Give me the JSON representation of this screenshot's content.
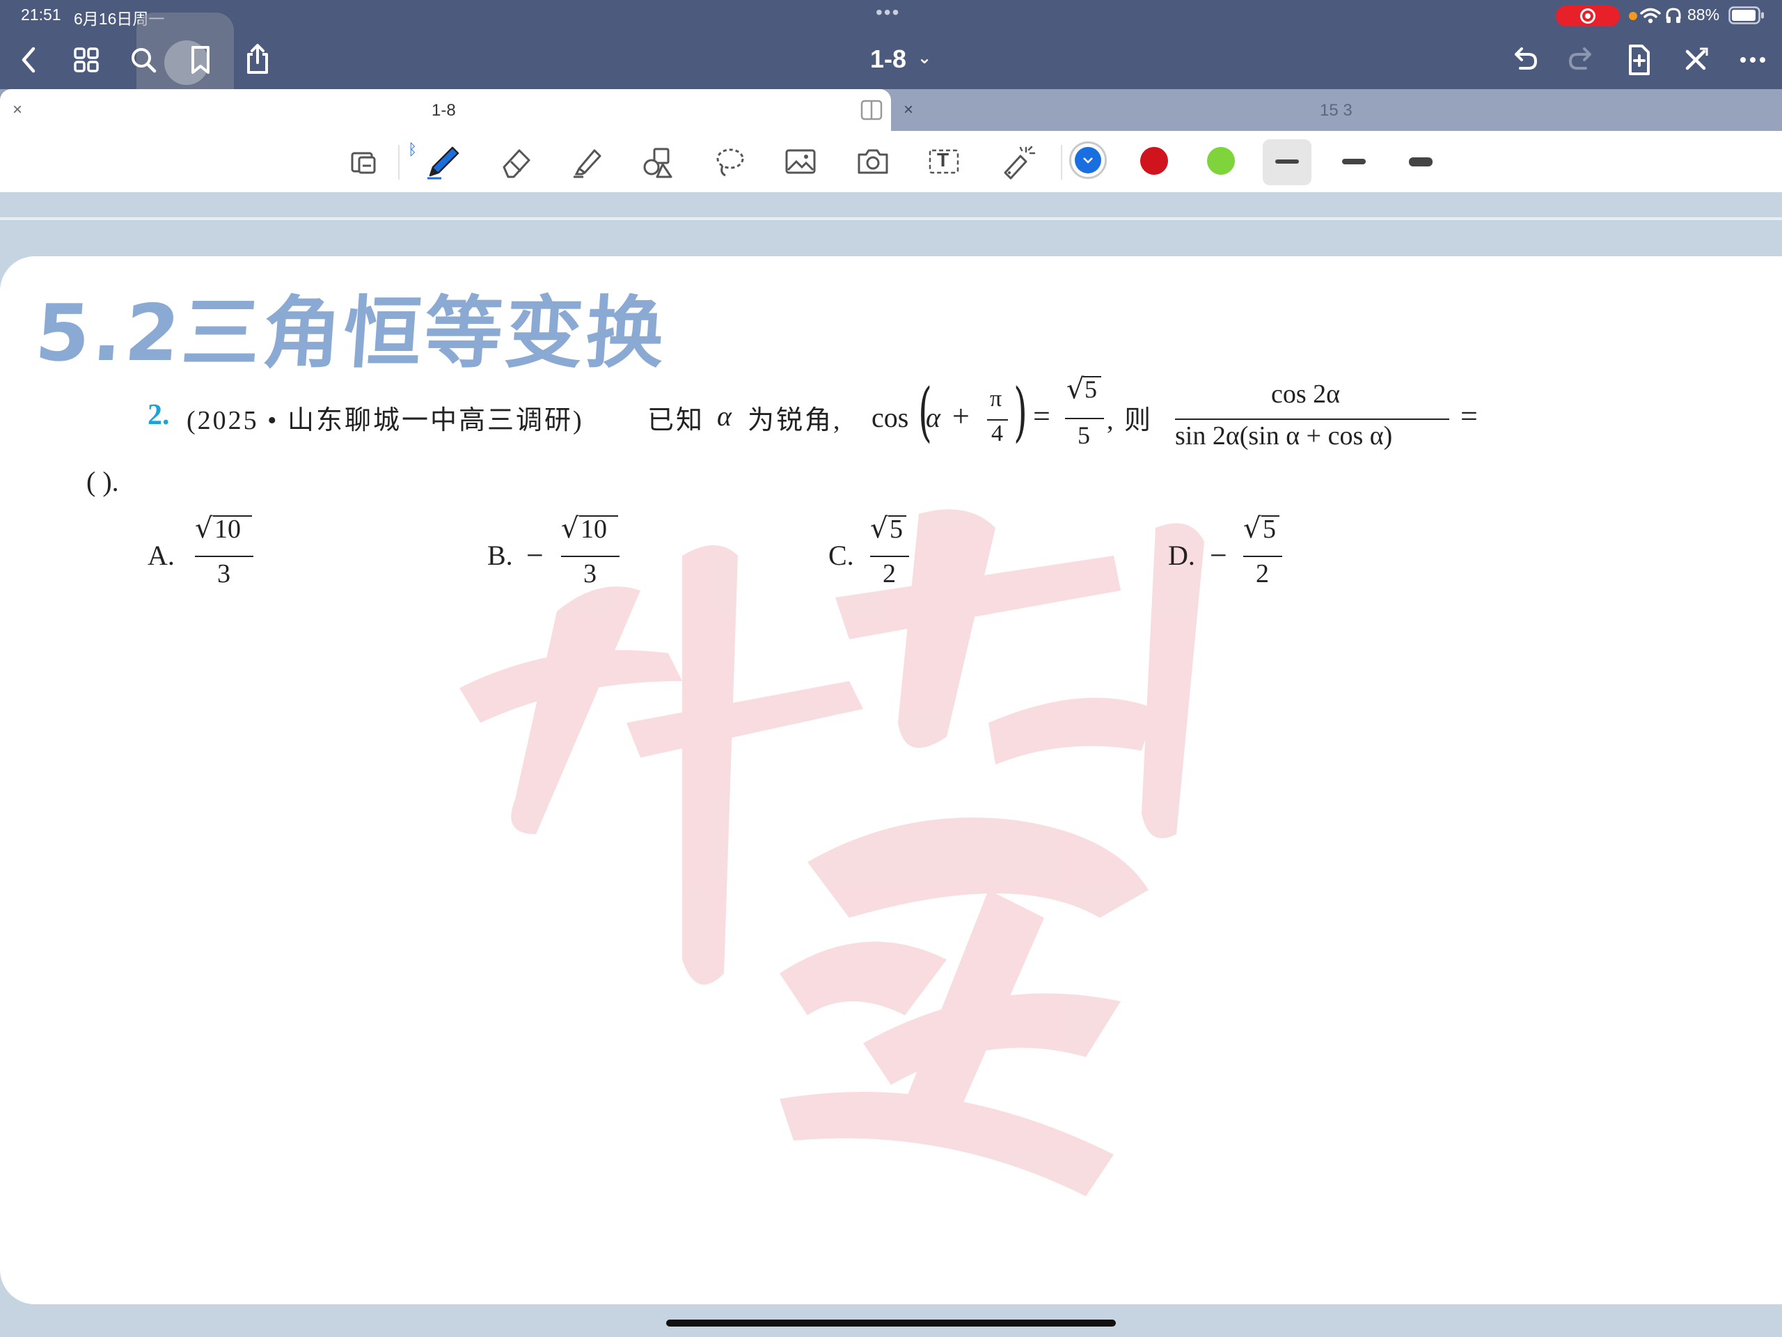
{
  "status_bar": {
    "time": "21:51",
    "date": "6月16日周一",
    "dots": "•••",
    "battery_percent": "88%"
  },
  "nav_bar": {
    "document_title": "1-8",
    "title_chevron": "⌄",
    "icons": [
      "back-icon",
      "grid-icon",
      "search-icon",
      "bookmark-icon",
      "share-icon",
      "undo-icon",
      "redo-icon",
      "add-page-icon",
      "close-icon",
      "more-icon"
    ]
  },
  "tabs": [
    {
      "label": "1-8",
      "close": "×",
      "active": true
    },
    {
      "label": "15 3",
      "close": "×",
      "active": false
    }
  ],
  "toolbar": {
    "tools": [
      "reader-mode-icon",
      "pen-icon",
      "eraser-icon",
      "highlighter-icon",
      "shapes-icon",
      "lasso-icon",
      "image-icon",
      "camera-icon",
      "text-icon",
      "laser-pointer-icon"
    ],
    "pen_connection_glyph": "ᛒ",
    "text_tool_glyph": "T",
    "colors": [
      "#1a6fe0",
      "#d0141d",
      "#7fd43c"
    ],
    "selected_color_index": 0,
    "stroke_widths": [
      "thin",
      "medium",
      "thick"
    ],
    "selected_stroke_index": 0
  },
  "page": {
    "heading": "5.2三角恒等变换",
    "question": {
      "number": "2.",
      "source": "(2025 • 山东聊城一中高三调研)",
      "intro": "已知",
      "alpha": "α",
      "condition_text": "为锐角,",
      "cos": "cos",
      "plus": "+",
      "pi": "π",
      "four": "4",
      "equals": "=",
      "five": "5",
      "then": ", 则",
      "numerator": "cos 2α",
      "denominator": "sin 2α(sin α + cos α)",
      "trailing_equals": "=",
      "answer_blank": "(        ).",
      "options": [
        {
          "letter": "A.",
          "sign": "",
          "radicand": "10",
          "denominator": "3"
        },
        {
          "letter": "B.",
          "sign": "−",
          "radicand": "10",
          "denominator": "3"
        },
        {
          "letter": "C.",
          "sign": "",
          "radicand": "5",
          "denominator": "2"
        },
        {
          "letter": "D.",
          "sign": "−",
          "radicand": "5",
          "denominator": "2"
        }
      ]
    }
  },
  "colors": {
    "nav_background": "#4c5a7e",
    "tab_strip": "#97a3bc",
    "page_frame": "#c6d4e2",
    "heading": "#8aa9d3",
    "question_number": "#1ba4dc",
    "record_indicator": "#e8202a"
  }
}
